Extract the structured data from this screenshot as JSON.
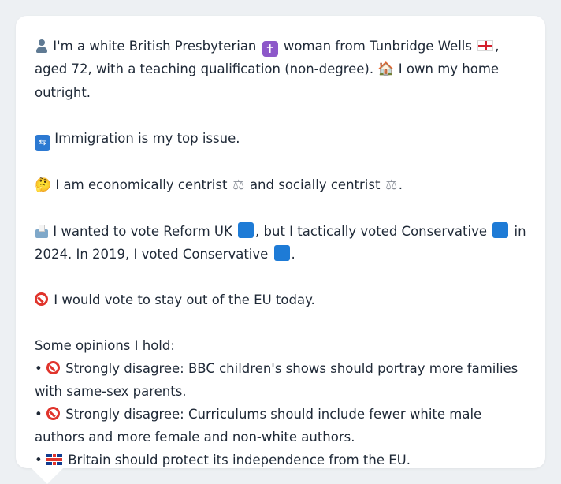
{
  "persona": {
    "line1_a": "I'm a white British Presbyterian",
    "line1_b": "woman from Tunbridge Wells",
    "line1_c": ", aged 72, with a teaching qualification (non-degree).",
    "line1_d": "I own my home outright.",
    "issue": "Immigration is my top issue.",
    "economics_a": "I am economically centrist",
    "economics_b": "and socially centrist",
    "economics_c": ".",
    "vote_a": "I wanted to vote Reform UK",
    "vote_b": ", but I tactically voted Conservative",
    "vote_c": "in 2024. In 2019, I voted Conservative",
    "vote_d": ".",
    "eu": "I would vote to stay out of the EU today.",
    "opinions_heading": "Some opinions I hold:",
    "opinions": [
      "Strongly disagree: BBC children's shows should portray more families with same-sex parents.",
      "Strongly disagree: Curriculums should include fewer white male authors and more female and non-white authors.",
      "Britain should protect its independence from the EU."
    ]
  },
  "icons": {
    "person": "person-icon",
    "religion": "latin-cross-icon",
    "flag_england": "england-flag-icon",
    "home": "house-icon",
    "immigration": "immigration-icon",
    "thinking": "thinking-face-icon",
    "scales": "balance-scale-icon",
    "ballot": "ballot-box-icon",
    "party": "blue-square-icon",
    "prohibited": "prohibited-icon",
    "flag_uk": "uk-flag-icon"
  },
  "colors": {
    "background": "#edf0f3",
    "card": "#ffffff",
    "text": "#1f2937",
    "party_blue": "#1e7bd6",
    "prohibited_red": "#e0342c"
  }
}
